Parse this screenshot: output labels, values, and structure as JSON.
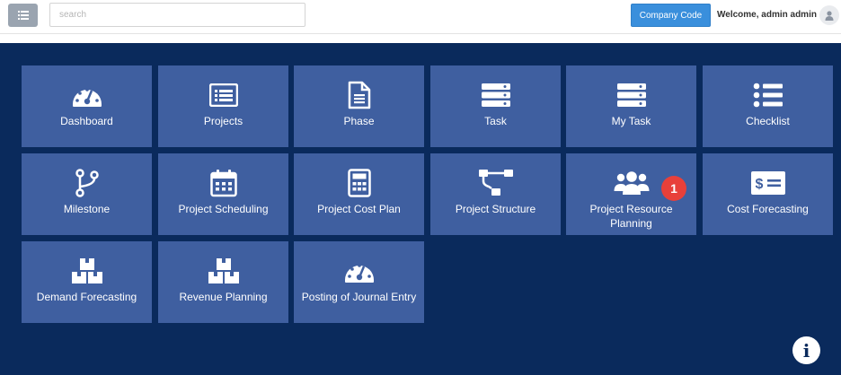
{
  "header": {
    "search_placeholder": "search",
    "company_code_label": "Company Code",
    "welcome_text": "Welcome, admin admin"
  },
  "tiles": [
    {
      "label": "Dashboard",
      "icon": "gauge-icon"
    },
    {
      "label": "Projects",
      "icon": "list-card-icon"
    },
    {
      "label": "Phase",
      "icon": "document-icon"
    },
    {
      "label": "Task",
      "icon": "server-icon"
    },
    {
      "label": "My Task",
      "icon": "server-icon"
    },
    {
      "label": "Checklist",
      "icon": "bullet-list-icon"
    },
    {
      "label": "Milestone",
      "icon": "branch-icon"
    },
    {
      "label": "Project Scheduling",
      "icon": "calendar-icon"
    },
    {
      "label": "Project Cost Plan",
      "icon": "calculator-icon"
    },
    {
      "label": "Project Structure",
      "icon": "sitemap-icon"
    },
    {
      "label": "Project Resource Planning",
      "icon": "users-icon"
    },
    {
      "label": "Cost Forecasting",
      "icon": "money-bill-icon"
    },
    {
      "label": "Demand Forecasting",
      "icon": "boxes-icon"
    },
    {
      "label": "Revenue Planning",
      "icon": "boxes-icon"
    },
    {
      "label": "Posting of Journal Entry",
      "icon": "gauge-icon"
    }
  ],
  "badge": {
    "count": "1"
  },
  "info_button": {
    "glyph": "i"
  },
  "colors": {
    "panel": "#0a2a5c",
    "tile": "#3f5fa0",
    "accent": "#3a8fdc",
    "badge": "#e8403a"
  }
}
